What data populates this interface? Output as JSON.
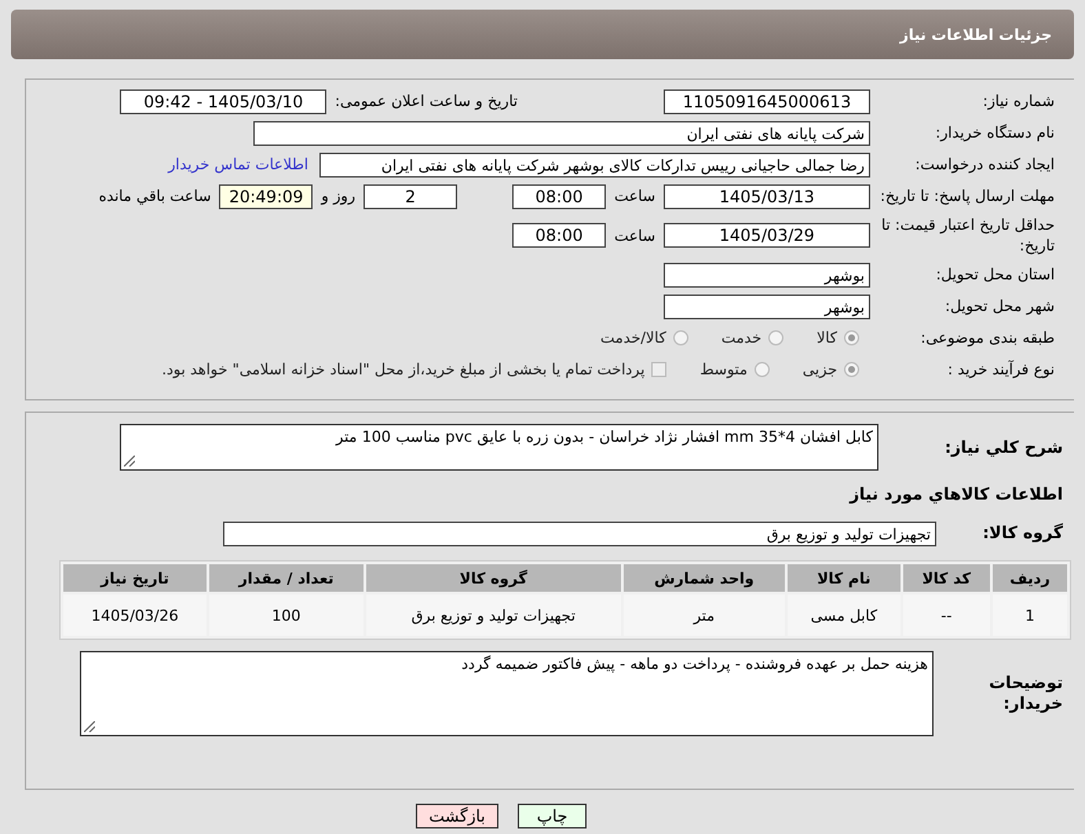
{
  "header": {
    "title": "جزئیات اطلاعات نیاز"
  },
  "fields": {
    "need_number": {
      "label": "شماره نیاز:",
      "value": "1105091645000613"
    },
    "announce": {
      "label": "تاریخ و ساعت اعلان عمومی:",
      "value": "1405/03/10 - 09:42"
    },
    "buyer_org": {
      "label": "نام دستگاه خریدار:",
      "value": "شرکت پایانه های نفتی ایران"
    },
    "creator": {
      "label": "ایجاد کننده درخواست:",
      "value": "رضا جمالی حاجیانی رییس تدارکات کالای بوشهر شرکت پایانه های نفتی ایران",
      "link": "اطلاعات تماس خریدار"
    },
    "deadline": {
      "label": "مهلت ارسال پاسخ: تا تاریخ:",
      "date": "1405/03/13",
      "time_label": "ساعت",
      "time": "08:00",
      "days": "2",
      "days_label": "روز و",
      "remaining": "20:49:09",
      "remaining_label": "ساعت باقي مانده"
    },
    "validity": {
      "label": "حداقل تاریخ اعتبار قیمت: تا تاریخ:",
      "date": "1405/03/29",
      "time_label": "ساعت",
      "time": "08:00"
    },
    "province": {
      "label": "استان محل تحویل:",
      "value": "بوشهر"
    },
    "city": {
      "label": "شهر محل تحویل:",
      "value": "بوشهر"
    },
    "category": {
      "label": "طبقه بندی موضوعی:",
      "options": [
        {
          "label": "کالا",
          "selected": true
        },
        {
          "label": "خدمت",
          "selected": false
        },
        {
          "label": "کالا/خدمت",
          "selected": false
        }
      ]
    },
    "process": {
      "label": "نوع فرآیند خرید :",
      "options": [
        {
          "label": "جزیی",
          "selected": true
        },
        {
          "label": "متوسط",
          "selected": false
        }
      ],
      "payment": {
        "label": "پرداخت تمام یا بخشی از مبلغ خرید،از محل \"اسناد خزانه اسلامی\" خواهد بود.",
        "checked": false
      }
    }
  },
  "description": {
    "label": "شرح کلي نياز:",
    "value": "کابل افشان  4*35 mm افشار نژاد خراسان - بدون زره با عایق pvc مناسب 100 متر"
  },
  "goods_heading": "اطلاعات کالاهاي مورد نياز",
  "goods_group": {
    "label": "گروه کالا:",
    "value": "تجهیزات تولید و توزیع برق"
  },
  "table": {
    "columns": [
      "ردیف",
      "کد کالا",
      "نام کالا",
      "واحد شمارش",
      "گروه کالا",
      "تعداد / مقدار",
      "تاریخ نیاز"
    ],
    "rows": [
      [
        "1",
        "--",
        "کابل مسی",
        "متر",
        "تجهیزات تولید و توزیع برق",
        "100",
        "1405/03/26"
      ]
    ]
  },
  "buyer_notes": {
    "label": "توضیحات خریدار:",
    "value": "هزینه حمل بر عهده فروشنده - پرداخت دو ماهه - پیش فاکتور ضمیمه گردد"
  },
  "buttons": [
    {
      "label": "چاپ",
      "kind": "print"
    },
    {
      "label": "بازگشت",
      "kind": "back"
    }
  ]
}
